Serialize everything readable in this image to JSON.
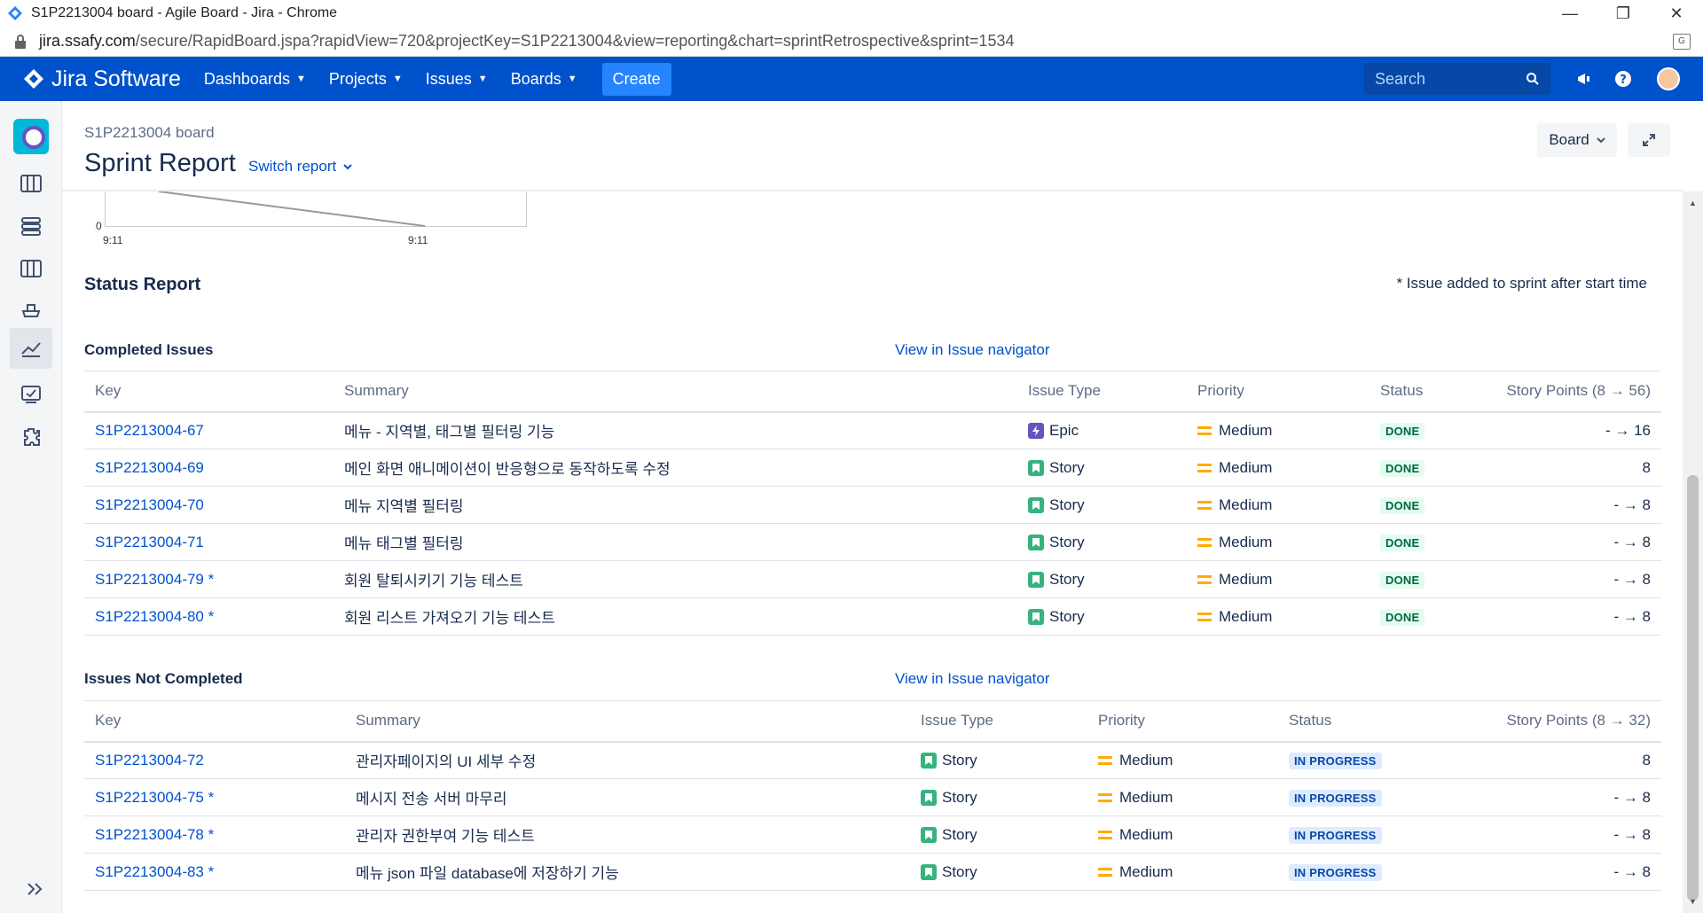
{
  "browser": {
    "tab_title": "S1P2213004 board - Agile Board - Jira - Chrome",
    "url_domain": "jira.ssafy.com",
    "url_path": "/secure/RapidBoard.jspa?rapidView=720&projectKey=S1P2213004&view=reporting&chart=sprintRetrospective&sprint=1534"
  },
  "topnav": {
    "product": "Jira Software",
    "items": [
      {
        "label": "Dashboards"
      },
      {
        "label": "Projects"
      },
      {
        "label": "Issues"
      },
      {
        "label": "Boards"
      }
    ],
    "create_label": "Create",
    "search_placeholder": "Search"
  },
  "header": {
    "breadcrumb": "S1P2213004 board",
    "title": "Sprint Report",
    "switch_report": "Switch report",
    "board_button": "Board"
  },
  "chart_fragment": {
    "y_tick": "0",
    "x_ticks": [
      "9:11",
      "9:11"
    ]
  },
  "status_report": {
    "title": "Status Report",
    "note": "* Issue added to sprint after start time"
  },
  "completed": {
    "title": "Completed Issues",
    "navigator_link": "View in Issue navigator",
    "columns": [
      "Key",
      "Summary",
      "Issue Type",
      "Priority",
      "Status",
      "Story Points (8 → 56)"
    ],
    "rows": [
      {
        "key": "S1P2213004-67",
        "summary": "메뉴 - 지역별, 태그별 필터링 기능",
        "type": "Epic",
        "priority": "Medium",
        "status": "DONE",
        "points": "- → 16"
      },
      {
        "key": "S1P2213004-69",
        "summary": "메인 화면 애니메이션이 반응형으로 동작하도록 수정",
        "type": "Story",
        "priority": "Medium",
        "status": "DONE",
        "points": "8"
      },
      {
        "key": "S1P2213004-70",
        "summary": "메뉴 지역별 필터링",
        "type": "Story",
        "priority": "Medium",
        "status": "DONE",
        "points": "- → 8"
      },
      {
        "key": "S1P2213004-71",
        "summary": "메뉴 태그별 필터링",
        "type": "Story",
        "priority": "Medium",
        "status": "DONE",
        "points": "- → 8"
      },
      {
        "key": "S1P2213004-79 *",
        "summary": "회원 탈퇴시키기 기능 테스트",
        "type": "Story",
        "priority": "Medium",
        "status": "DONE",
        "points": "- → 8"
      },
      {
        "key": "S1P2213004-80 *",
        "summary": "회원 리스트 가져오기 기능 테스트",
        "type": "Story",
        "priority": "Medium",
        "status": "DONE",
        "points": "- → 8"
      }
    ]
  },
  "not_completed": {
    "title": "Issues Not Completed",
    "navigator_link": "View in Issue navigator",
    "columns": [
      "Key",
      "Summary",
      "Issue Type",
      "Priority",
      "Status",
      "Story Points (8 → 32)"
    ],
    "rows": [
      {
        "key": "S1P2213004-72",
        "summary": "관리자페이지의 UI 세부 수정",
        "type": "Story",
        "priority": "Medium",
        "status": "IN PROGRESS",
        "points": "8"
      },
      {
        "key": "S1P2213004-75 *",
        "summary": "메시지 전송 서버 마무리",
        "type": "Story",
        "priority": "Medium",
        "status": "IN PROGRESS",
        "points": "- → 8"
      },
      {
        "key": "S1P2213004-78 *",
        "summary": "관리자 권한부여 기능 테스트",
        "type": "Story",
        "priority": "Medium",
        "status": "IN PROGRESS",
        "points": "- → 8"
      },
      {
        "key": "S1P2213004-83 *",
        "summary": "메뉴 json 파일 database에 저장하기 기능",
        "type": "Story",
        "priority": "Medium",
        "status": "IN PROGRESS",
        "points": "- → 8"
      }
    ]
  },
  "colors": {
    "nav_bg": "#0052cc",
    "create_btn": "#2684ff",
    "link": "#0052cc",
    "story": "#36b37e",
    "epic": "#6554c0",
    "priority_medium": "#ffab00"
  }
}
